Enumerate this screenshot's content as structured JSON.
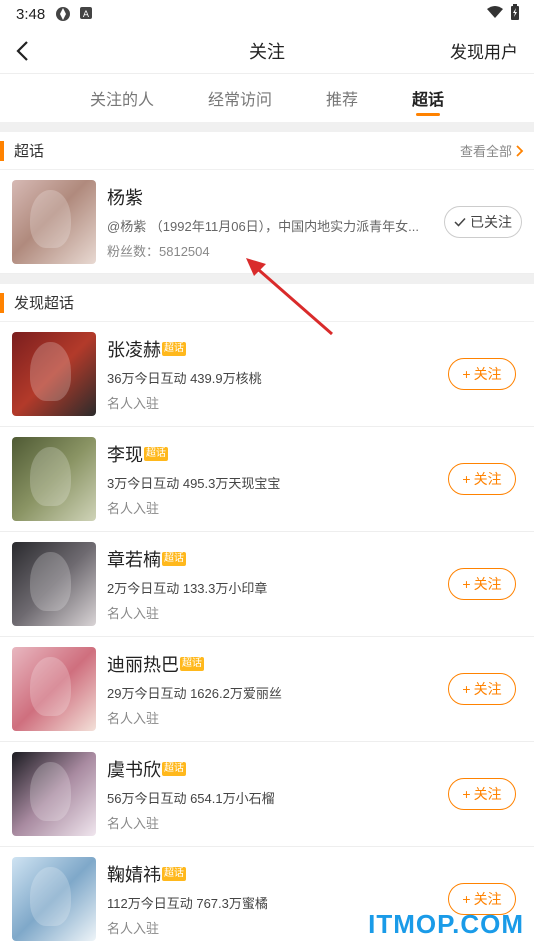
{
  "status_bar": {
    "time": "3:48"
  },
  "header": {
    "title": "关注",
    "right_label": "发现用户"
  },
  "tabs": [
    {
      "label": "关注的人",
      "active": false
    },
    {
      "label": "经常访问",
      "active": false
    },
    {
      "label": "推荐",
      "active": false
    },
    {
      "label": "超话",
      "active": true
    }
  ],
  "supertopic_section": {
    "title": "超话",
    "see_all": "查看全部"
  },
  "featured": {
    "name": "杨紫",
    "desc": "@杨紫 （1992年11月06日），中国内地实力派青年女...",
    "fans": "粉丝数：5812504",
    "button": "已关注"
  },
  "discover_section": {
    "title": "发现超话"
  },
  "badge_label": "超话",
  "follow_label": "关注",
  "items": [
    {
      "name": "张凌赫",
      "stats": "36万今日互动 439.9万核桃",
      "sub": "名人入驻"
    },
    {
      "name": "李现",
      "stats": "3万今日互动 495.3万天现宝宝",
      "sub": "名人入驻"
    },
    {
      "name": "章若楠",
      "stats": "2万今日互动 133.3万小印章",
      "sub": "名人入驻"
    },
    {
      "name": "迪丽热巴",
      "stats": "29万今日互动 1626.2万爱丽丝",
      "sub": "名人入驻"
    },
    {
      "name": "虞书欣",
      "stats": "56万今日互动 654.1万小石榴",
      "sub": "名人入驻"
    },
    {
      "name": "鞠婧祎",
      "stats": "112万今日互动 767.3万蜜橘",
      "sub": "名人入驻"
    }
  ],
  "watermark": "ITMOP.COM",
  "colors": {
    "accent": "#ff8200",
    "badge": "#ffb81c",
    "annotation_arrow": "#d92b2b"
  }
}
